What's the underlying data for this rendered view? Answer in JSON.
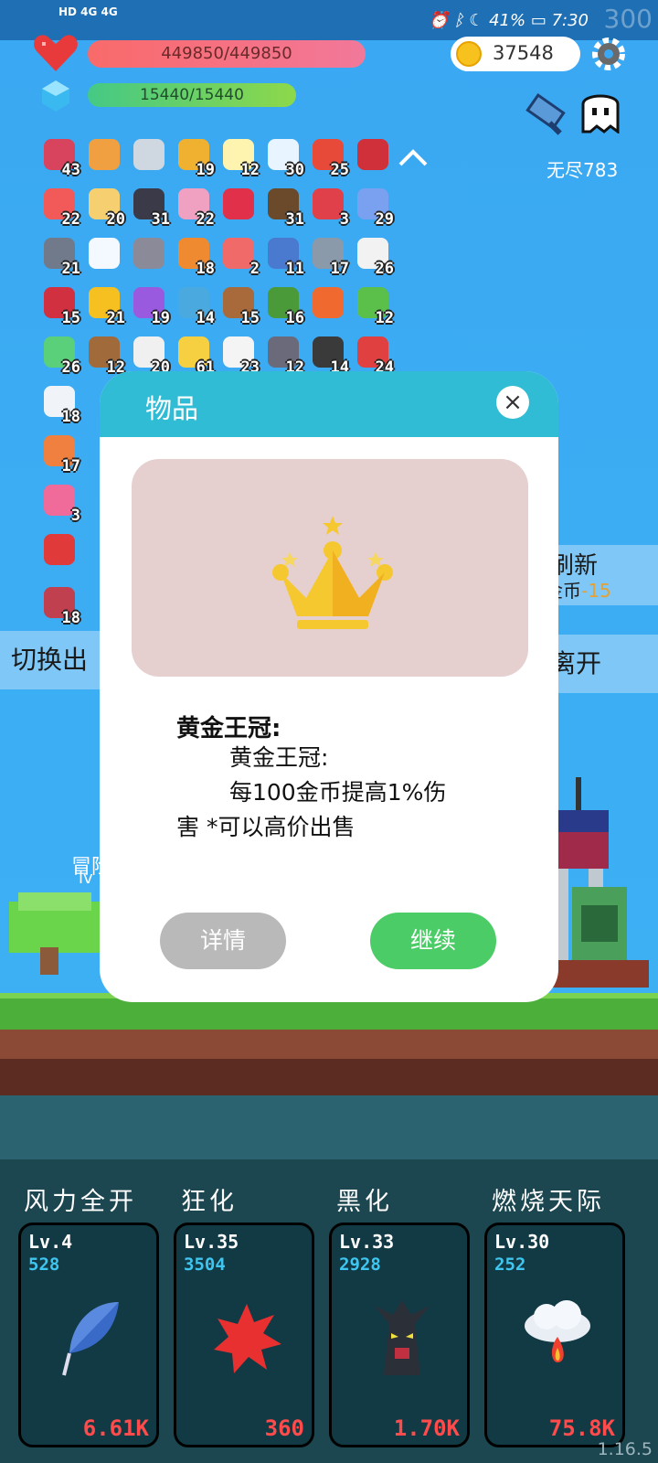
{
  "status_bar": {
    "left_top": "HD 4G 4G",
    "battery": "41%",
    "time": "7:30",
    "faint_number": "300"
  },
  "hud": {
    "hp": "449850/449850",
    "mp": "15440/15440",
    "coins": "37548",
    "endless_label": "无尽783"
  },
  "items": [
    {
      "icon": "jam-jar",
      "color": "#d8435e",
      "count": "43"
    },
    {
      "icon": "scroll-recipe",
      "color": "#f0a040",
      "count": ""
    },
    {
      "icon": "sword",
      "color": "#cfd8e0",
      "count": ""
    },
    {
      "icon": "book",
      "color": "#f0b030",
      "count": "19"
    },
    {
      "icon": "flower",
      "color": "#fff3b0",
      "count": "12"
    },
    {
      "icon": "star-card",
      "color": "#e8f4ff",
      "count": "30"
    },
    {
      "icon": "sock",
      "color": "#e84a3a",
      "count": "25"
    },
    {
      "icon": "magnet",
      "color": "#d0303a",
      "count": ""
    },
    {
      "icon": "pill",
      "color": "#f25a5a",
      "count": "22"
    },
    {
      "icon": "note-pencil",
      "color": "#f6d070",
      "count": "20"
    },
    {
      "icon": "bat",
      "color": "#3a3a48",
      "count": "31"
    },
    {
      "icon": "ice-cream",
      "color": "#f0a0c0",
      "count": "22"
    },
    {
      "icon": "gem",
      "color": "#e0304a",
      "count": ""
    },
    {
      "icon": "coconut",
      "color": "#6a4a2a",
      "count": "31"
    },
    {
      "icon": "watermelon",
      "color": "#e0404a",
      "count": "3"
    },
    {
      "icon": "capsule",
      "color": "#7aa0f0",
      "count": "29"
    },
    {
      "icon": "dumbbell",
      "color": "#707a8a",
      "count": "21"
    },
    {
      "icon": "wing",
      "color": "#f4f8ff",
      "count": ""
    },
    {
      "icon": "helmet",
      "color": "#8a8a98",
      "count": ""
    },
    {
      "icon": "meteor",
      "color": "#f08a30",
      "count": "18"
    },
    {
      "icon": "meat",
      "color": "#f06a6a",
      "count": "2"
    },
    {
      "icon": "shield",
      "color": "#4a7ad0",
      "count": "11"
    },
    {
      "icon": "compass",
      "color": "#8a9aaa",
      "count": "17"
    },
    {
      "icon": "dice",
      "color": "#f2f2f2",
      "count": "26"
    },
    {
      "icon": "bomb",
      "color": "#d03040",
      "count": "15"
    },
    {
      "icon": "sunflower",
      "color": "#f6c020",
      "count": "21"
    },
    {
      "icon": "hat",
      "color": "#9a5ae0",
      "count": "19"
    },
    {
      "icon": "target",
      "color": "#4aaae0",
      "count": "14"
    },
    {
      "icon": "round-shield",
      "color": "#a86a3a",
      "count": "15"
    },
    {
      "icon": "green-helmet",
      "color": "#4a9a3a",
      "count": "16"
    },
    {
      "icon": "torch",
      "color": "#f06a30",
      "count": ""
    },
    {
      "icon": "goblin",
      "color": "#5ac04a",
      "count": "12"
    },
    {
      "icon": "slime",
      "color": "#5ad07a",
      "count": "26"
    },
    {
      "icon": "bow",
      "color": "#a06a3a",
      "count": "12"
    },
    {
      "icon": "cards",
      "color": "#f0f0f0",
      "count": "20"
    },
    {
      "icon": "lamp",
      "color": "#f6d040",
      "count": "61"
    },
    {
      "icon": "ghost",
      "color": "#f4f4f4",
      "count": "23"
    },
    {
      "icon": "hook",
      "color": "#6a6a7a",
      "count": "12"
    },
    {
      "icon": "cauldron",
      "color": "#3a3a3a",
      "count": "14"
    },
    {
      "icon": "gift",
      "color": "#e04040",
      "count": "24"
    },
    {
      "icon": "envelope",
      "color": "#f0f4f8",
      "count": "18"
    },
    {
      "icon": "sailboat",
      "color": "#f08040",
      "count": "17"
    },
    {
      "icon": "spray-bottle",
      "color": "#f06a9a",
      "count": "3"
    },
    {
      "icon": "apple",
      "color": "#e03a3a",
      "count": ""
    },
    {
      "icon": "striped-card",
      "color": "#c04050",
      "count": "18"
    }
  ],
  "side_buttons": {
    "switch": "切换出",
    "refresh": "刷新",
    "refresh_cost_label": "金币",
    "refresh_cost": "-15",
    "leave": "离开"
  },
  "scene": {
    "hero_label": "冒险",
    "hero_sub": "lv"
  },
  "modal": {
    "title": "物品",
    "close": "×",
    "item_name": "黄金王冠:",
    "desc_line1": "黄金王冠:",
    "desc_line2": "每100金币提高1%伤",
    "desc_line3": "害 *可以高价出售",
    "detail_button": "详情",
    "continue_button": "继续"
  },
  "skills": [
    {
      "name": "风力全开",
      "level": "Lv.4",
      "value": "528",
      "cost": "6.61K",
      "icon": "feather"
    },
    {
      "name": "狂化",
      "level": "Lv.35",
      "value": "3504",
      "cost": "360",
      "icon": "red-splat"
    },
    {
      "name": "黑化",
      "level": "Lv.33",
      "value": "2928",
      "cost": "1.70K",
      "icon": "dark-tree"
    },
    {
      "name": "燃烧天际",
      "level": "Lv.30",
      "value": "252",
      "cost": "75.8K",
      "icon": "fire-cloud"
    }
  ],
  "version": "1.16.5",
  "colors": {
    "sky": "#3aa8f2",
    "modal_header": "#2fbcd4",
    "continue": "#4ccc67",
    "detail": "#b9b9b9",
    "hp": "#f96a6a",
    "mp": "#45c985"
  }
}
